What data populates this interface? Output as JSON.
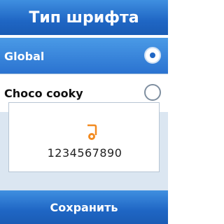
{
  "header": {
    "title": "Тип шрифта"
  },
  "options": [
    {
      "label": "Global",
      "selected": true
    },
    {
      "label": "Choco cooky",
      "selected": false
    }
  ],
  "preview": {
    "text": "1234567890"
  },
  "footer": {
    "save_label": "Сохранить"
  },
  "colors": {
    "accent": "#1f66c4",
    "selected_row": "#2a72d0",
    "preview_bg": "#dbe6f1"
  }
}
